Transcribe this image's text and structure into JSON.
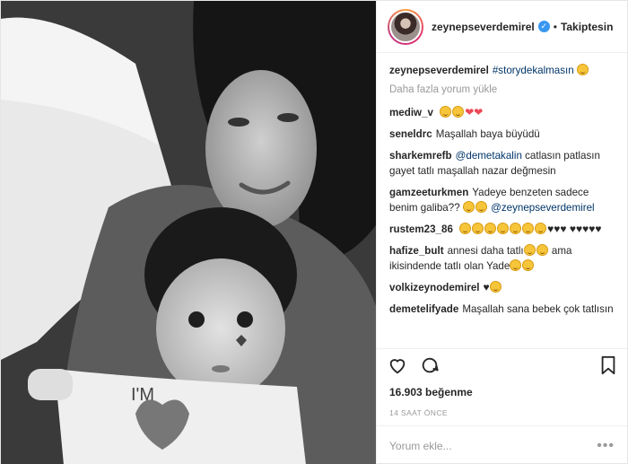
{
  "header": {
    "username": "zeynepseverdemirel",
    "dot": "•",
    "follow_label": "Takiptesin"
  },
  "caption": {
    "username": "zeynepseverdemirel",
    "hashtag": "#storydekalmasın"
  },
  "load_more": "Daha fazla yorum yükle",
  "comments": [
    {
      "user": "mediw_v",
      "text": ""
    },
    {
      "user": "seneldrc",
      "text": "Maşallah baya büyüdü"
    },
    {
      "user": "sharkemrefb",
      "mention": "@demetakalin",
      "text": " catlasın patlasın gayet tatlı maşallah nazar değmesin"
    },
    {
      "user": "gamzeeturkmen",
      "text": "Yadeye benzeten sadece benim galiba?? ",
      "mention": "@zeynepseverdemirel"
    },
    {
      "user": "rustem23_86",
      "text": ""
    },
    {
      "user": "hafize_bult",
      "text_a": "annesi daha tatlı",
      "text_b": " ama ikisindende tatlı olan Yade"
    },
    {
      "user": "volkizeynodemirel",
      "text": ""
    },
    {
      "user": "demetelifyade",
      "text": "Maşallah sana bebek çok tatlısın"
    }
  ],
  "likes": "16.903 beğenme",
  "time": "14 SAAT ÖNCE",
  "add_comment": {
    "placeholder": "Yorum ekle..."
  },
  "icons": [
    "heart-icon",
    "comment-icon",
    "bookmark-icon",
    "more-icon",
    "verified-icon"
  ],
  "colors": {
    "link": "#003569",
    "verified": "#3897f0",
    "like_red": "#ed4956",
    "muted": "#999999"
  }
}
